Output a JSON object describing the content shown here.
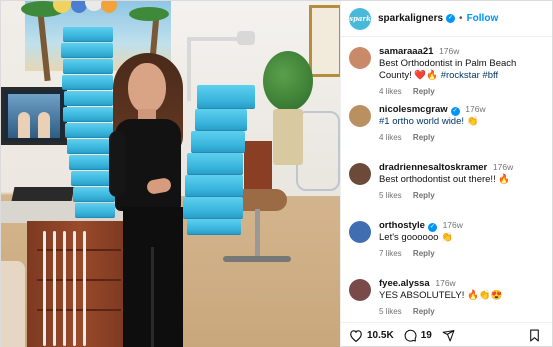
{
  "account": {
    "username": "sparkaligners",
    "separator": "•",
    "follow_label": "Follow",
    "avatar_text": "spark",
    "verified": true
  },
  "comments": [
    {
      "username": "samaraaa21",
      "time": "176w",
      "text": "Best Orthodontist in Palm Beach County! ",
      "emoji": "❤️🔥",
      "hashtags": " #rockstar #bff",
      "likes": "4 likes",
      "reply": "Reply",
      "avatar_color": "#c98a6a",
      "verified": false
    },
    {
      "username": "nicolesmcgraw",
      "time": "176w",
      "text": "#1 ortho world wide! ",
      "emoji": "👏",
      "hashtags": "",
      "likes": "4 likes",
      "reply": "Reply",
      "avatar_color": "#b9905f",
      "verified": true
    },
    {
      "username": "dradriennesaltoskramer",
      "time": "176w",
      "text": "Best orthodontist out there!! ",
      "emoji": "🔥",
      "hashtags": "",
      "likes": "5 likes",
      "reply": "Reply",
      "avatar_color": "#6b4a3a",
      "verified": false
    },
    {
      "username": "orthostyle",
      "time": "176w",
      "text": "Let's goooooo ",
      "emoji": "👏",
      "hashtags": "",
      "likes": "7 likes",
      "reply": "Reply",
      "avatar_color": "#3f6fb0",
      "verified": true
    },
    {
      "username": "fyee.alyssa",
      "time": "176w",
      "text": "YES ABSOLUTELY! ",
      "emoji": "🔥👏😍",
      "hashtags": "",
      "likes": "5 likes",
      "reply": "Reply",
      "avatar_color": "#7a4a4a",
      "verified": false
    }
  ],
  "actions": {
    "like_icon": "heart-icon",
    "like_count": "10.5K",
    "comment_icon": "comment-icon",
    "comment_count": "19",
    "share_icon": "share-icon",
    "save_icon": "bookmark-icon"
  },
  "colors": {
    "brand": "#49b9d9",
    "link": "#0095f6",
    "hashtag": "#00376b",
    "box": "#3fb9e0"
  }
}
